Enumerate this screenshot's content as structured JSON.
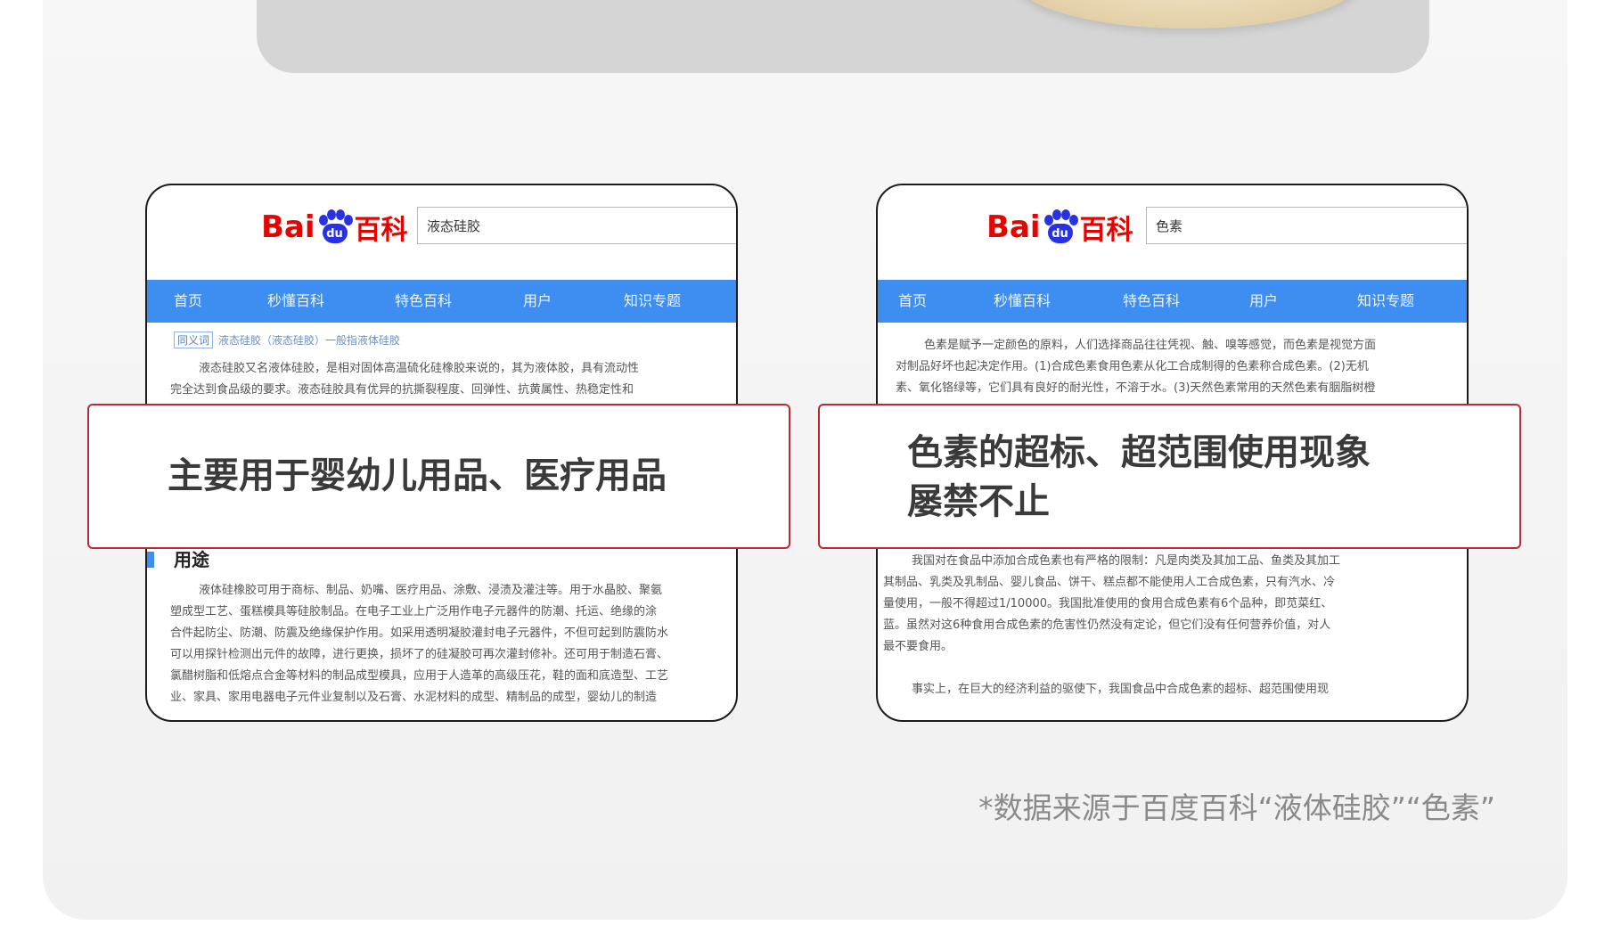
{
  "left_card": {
    "logo": {
      "bai": "Bai",
      "du": "du",
      "baike": "百科"
    },
    "search_value": "液态硅胶",
    "nav": [
      "首页",
      "秒懂百科",
      "特色百科",
      "用户",
      "知识专题"
    ],
    "crumb_tag": "同义词",
    "crumb_text": "液态硅胶（液态硅胶）一般指液体硅胶",
    "intro_lines": [
      "液态硅胶又名液体硅胶，是相对固体高温硫化硅橡胶来说的，其为液体胶，具有流动性",
      "完全达到食品级的要求。液态硅胶具有优异的抗撕裂程度、回弹性、抗黄属性、热稳定性和"
    ],
    "section_title": "用途",
    "usage_lines": [
      "液体硅橡胶可用于商标、制品、奶嘴、医疗用品、涂敷、浸渍及灌注等。用于水晶胶、聚氨",
      "塑成型工艺、蛋糕模具等硅胶制品。在电子工业上广泛用作电子元器件的防潮、托运、绝缘的涂",
      "合件起防尘、防潮、防震及绝缘保护作用。如采用透明凝胶灌封电子元器件，不但可起到防震防水",
      "可以用探针检测出元件的故障，进行更换，损坏了的硅凝胶可再次灌封修补。还可用于制造石膏、",
      "氯醋树脂和低熔点合金等材料的制品成型模具，应用于人造革的高级压花，鞋的面和底造型、工艺",
      "业、家具、家用电器电子元件业复制以及石膏、水泥材料的成型、精制品的成型，婴幼儿的制造"
    ],
    "callout": "主要用于婴幼儿用品、医疗用品"
  },
  "right_card": {
    "logo": {
      "bai": "Bai",
      "du": "du",
      "baike": "百科"
    },
    "search_value": "色素",
    "nav": [
      "首页",
      "秒懂百科",
      "特色百科",
      "用户",
      "知识专题"
    ],
    "intro_lines": [
      "色素是赋予一定颜色的原料，人们选择商品往往凭视、触、嗅等感觉，而色素是视觉方面",
      "对制品好坏也起决定作用。(1)合成色素食用色素从化工合成制得的色素称合成色素。(2)无机",
      "素、氧化铬绿等，它们具有良好的耐光性，不溶于水。(3)天然色素常用的天然色素有胭脂树橙"
    ],
    "body_lines": [
      "我国对在食品中添加合成色素也有严格的限制：凡是肉类及其加工品、鱼类及其加工",
      "其制品、乳类及乳制品、婴儿食品、饼干、糕点都不能使用人工合成色素，只有汽水、冷",
      "量使用，一般不得超过1/10000。我国批准使用的食用合成色素有6个品种，即苋菜红、",
      "蓝。虽然对这6种食用合成色素的危害性仍然没有定论，但它们没有任何营养价值，对人",
      "最不要食用。",
      "",
      "事实上，在巨大的经济利益的驱使下，我国食品中合成色素的超标、超范围使用现"
    ],
    "callout_lines": [
      "色素的超标、超范围使用现象",
      "屡禁不止"
    ]
  },
  "source_note": "*数据来源于百度百科“液体硅胶”“色素”",
  "colors": {
    "accent_red": "#b92a38",
    "nav_blue": "#3d8ef0",
    "baidu_red": "#e10601",
    "baidu_blue": "#2932e1"
  }
}
